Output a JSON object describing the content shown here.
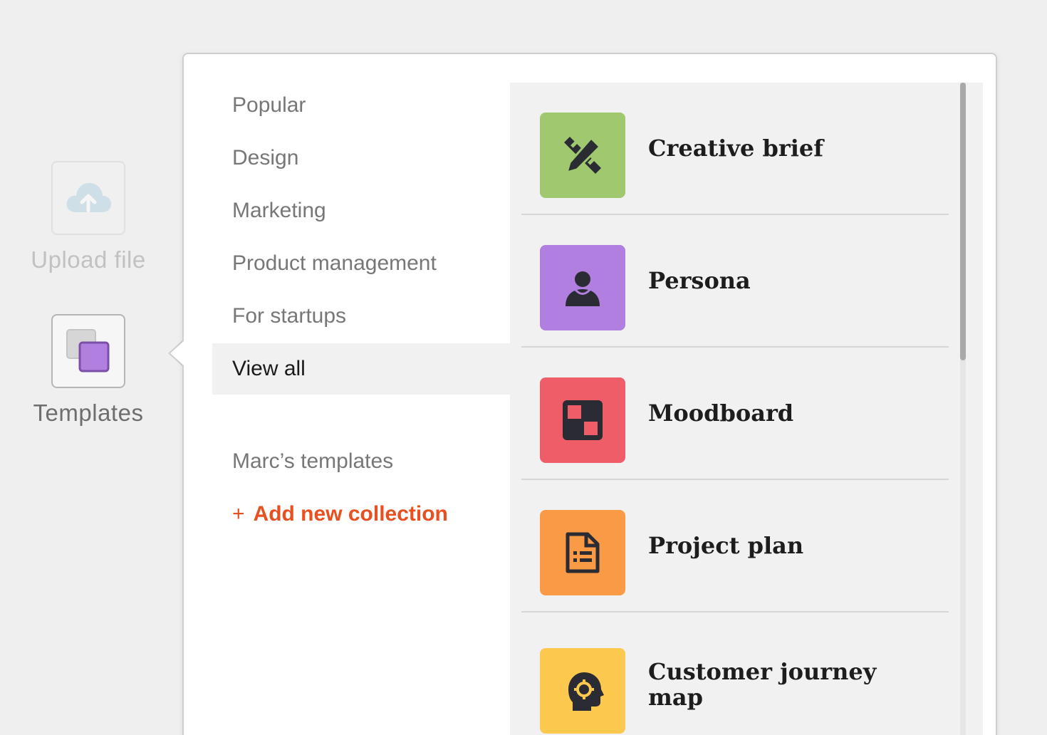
{
  "tools": {
    "upload": {
      "label": "Upload file",
      "icon": "cloud-upload-icon"
    },
    "templates": {
      "label": "Templates",
      "icon": "templates-icon"
    }
  },
  "menu": {
    "categories": [
      {
        "label": "Popular"
      },
      {
        "label": "Design"
      },
      {
        "label": "Marketing"
      },
      {
        "label": "Product management"
      },
      {
        "label": "For startups"
      },
      {
        "label": "View all",
        "selected": true
      }
    ],
    "my_templates": "Marc’s templates",
    "add_collection": {
      "plus": "+",
      "label": "Add new collection"
    }
  },
  "templates": [
    {
      "name": "Creative brief",
      "icon": "pencil-ruler-icon",
      "color": "#9fc86f"
    },
    {
      "name": "Persona",
      "icon": "person-icon",
      "color": "#b07fe0"
    },
    {
      "name": "Moodboard",
      "icon": "moodboard-grid-icon",
      "color": "#ef5d68"
    },
    {
      "name": "Project plan",
      "icon": "document-list-icon",
      "color": "#fb9a44"
    },
    {
      "name": "Customer journey map",
      "icon": "head-gear-icon",
      "color": "#fdc84e"
    }
  ],
  "colors": {
    "accent": "#e8501f",
    "selected_bg": "#f1f1f1",
    "icon_glyph": "#2b2b33"
  }
}
